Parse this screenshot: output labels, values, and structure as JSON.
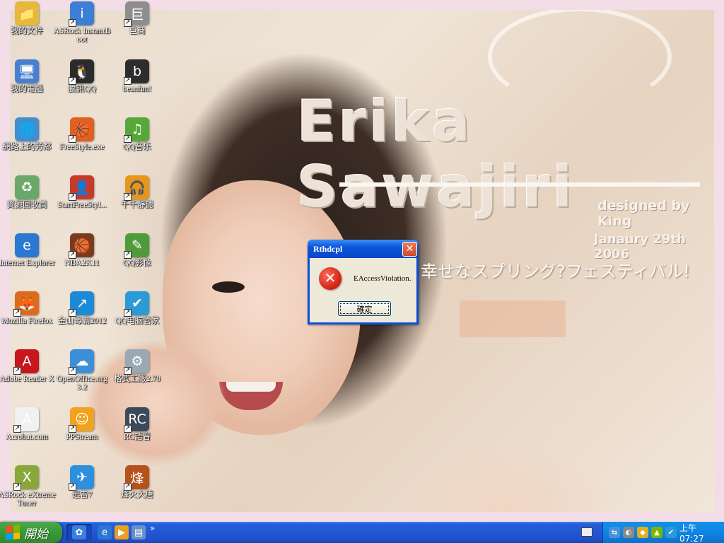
{
  "wallpaper": {
    "title": "Erika Sawajiri",
    "designed_by": "designed by King",
    "date": "Janaury 29th 2006",
    "japanese_text": "幸せなスプリング?フェスティバル!"
  },
  "desktop_icons": [
    {
      "label": "我的文件",
      "icon": "my-documents-icon",
      "glyph": "📁",
      "color": "#e7b83a",
      "shortcut": false
    },
    {
      "label": "我的電腦",
      "icon": "my-computer-icon",
      "glyph": "🖥",
      "color": "#4a7fd0",
      "shortcut": false
    },
    {
      "label": "網路上的芳鄰",
      "icon": "network-places-icon",
      "glyph": "🌐",
      "color": "#3f8fd1",
      "shortcut": false
    },
    {
      "label": "資源回收筒",
      "icon": "recycle-bin-icon",
      "glyph": "♻",
      "color": "#6aa86a",
      "shortcut": false
    },
    {
      "label": "Internet Explorer",
      "icon": "internet-explorer-icon",
      "glyph": "e",
      "color": "#2a78d2",
      "shortcut": false
    },
    {
      "label": "Mozilla Firefox",
      "icon": "firefox-icon",
      "glyph": "🦊",
      "color": "#e06a1c",
      "shortcut": true
    },
    {
      "label": "Adobe Reader X",
      "icon": "adobe-reader-icon",
      "glyph": "A",
      "color": "#c8161d",
      "shortcut": true
    },
    {
      "label": "Acrobat.com",
      "icon": "acrobat-com-icon",
      "glyph": "A",
      "color": "#f1f1f1",
      "shortcut": true
    },
    {
      "label": "ASRock eXtreme Tuner",
      "icon": "asrock-tuner-icon",
      "glyph": "X",
      "color": "#8aa83a",
      "shortcut": true
    },
    {
      "label": "ASRock InstantBoot",
      "icon": "asrock-instantboot-icon",
      "glyph": "i",
      "color": "#3d7fd4",
      "shortcut": true
    },
    {
      "label": "騰訊QQ",
      "icon": "qq-penguin-icon",
      "glyph": "🐧",
      "color": "#2b2b2b",
      "shortcut": true
    },
    {
      "label": "FreeStyle.exe",
      "icon": "basketball-icon",
      "glyph": "🏀",
      "color": "#e0601e",
      "shortcut": true
    },
    {
      "label": "StartFreeStyl...",
      "icon": "freestyle-player-icon",
      "glyph": "👤",
      "color": "#c63a2a",
      "shortcut": true
    },
    {
      "label": "NBA2K11",
      "icon": "nba2k11-icon",
      "glyph": "🏀",
      "color": "#7a3b1f",
      "shortcut": true
    },
    {
      "label": "金山毒霸2012",
      "icon": "kingsoft-antivirus-icon",
      "glyph": "↗",
      "color": "#1d8ad8",
      "shortcut": true
    },
    {
      "label": "OpenOffice.org 3.2",
      "icon": "openoffice-icon",
      "glyph": "☁",
      "color": "#3b8ed8",
      "shortcut": true
    },
    {
      "label": "PPStream",
      "icon": "ppstream-icon",
      "glyph": "☺",
      "color": "#f2a21d",
      "shortcut": true
    },
    {
      "label": "迅雷7",
      "icon": "thunder-bird-icon",
      "glyph": "✈",
      "color": "#2d8fe0",
      "shortcut": true
    },
    {
      "label": "巨商",
      "icon": "jushang-icon",
      "glyph": "巨",
      "color": "#8e8e8e",
      "shortcut": true
    },
    {
      "label": "beanfun!",
      "icon": "beanfun-icon",
      "glyph": "b",
      "color": "#2d2d2d",
      "shortcut": true
    },
    {
      "label": "QQ音乐",
      "icon": "qq-music-icon",
      "glyph": "♫",
      "color": "#57a83a",
      "shortcut": true
    },
    {
      "label": "千千靜聽",
      "icon": "ttplayer-icon",
      "glyph": "🎧",
      "color": "#e8961a",
      "shortcut": true
    },
    {
      "label": "QQ影像",
      "icon": "qq-image-icon",
      "glyph": "✎",
      "color": "#4f9a3a",
      "shortcut": true
    },
    {
      "label": "QQ电脑管家",
      "icon": "qq-pc-manager-icon",
      "glyph": "✔",
      "color": "#2a9ad8",
      "shortcut": true
    },
    {
      "label": "格式工廠2.70",
      "icon": "format-factory-icon",
      "glyph": "⚙",
      "color": "#9aa7b4",
      "shortcut": true
    },
    {
      "label": "RC語音",
      "icon": "rc-voice-icon",
      "glyph": "RC",
      "color": "#3a4a5a",
      "shortcut": true
    },
    {
      "label": "烽火大唐",
      "icon": "fenghuo-datang-icon",
      "glyph": "烽",
      "color": "#b8501a",
      "shortcut": true
    }
  ],
  "dialog": {
    "title": "Rthdcpl",
    "message": "EAccessViolation.",
    "ok_label": "確定",
    "close_glyph": "✕",
    "error_glyph": "✕"
  },
  "taskbar": {
    "start_label": "開始",
    "quick_launch": [
      {
        "icon": "windows-media-center-icon",
        "glyph": "✿",
        "color": "#3a7ee0"
      },
      {
        "icon": "internet-explorer-quick-icon",
        "glyph": "e",
        "color": "#2a78d2"
      },
      {
        "icon": "windows-media-player-icon",
        "glyph": "▶",
        "color": "#e8a020"
      },
      {
        "icon": "show-desktop-icon",
        "glyph": "▤",
        "color": "#6a8fc8"
      }
    ],
    "more_glyph": "»",
    "tray_icons": [
      {
        "icon": "network-tray-icon",
        "glyph": "⇆",
        "color": "#4a90d9"
      },
      {
        "icon": "volume-tray-icon",
        "glyph": "◐",
        "color": "#888"
      },
      {
        "icon": "security-shield-tray-icon",
        "glyph": "◆",
        "color": "#e0b020"
      },
      {
        "icon": "nvidia-tray-icon",
        "glyph": "▲",
        "color": "#76b900"
      },
      {
        "icon": "qq-manager-tray-icon",
        "glyph": "✔",
        "color": "#2a9ad8"
      }
    ],
    "clock": "上午 07:27"
  }
}
